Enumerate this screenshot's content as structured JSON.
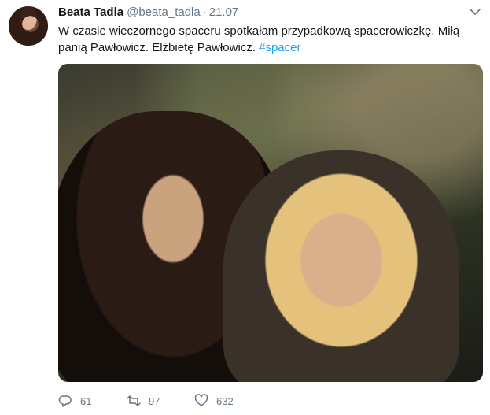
{
  "tweet": {
    "author_name": "Beata Tadla",
    "author_handle": "@beata_tadla",
    "separator": "·",
    "date": "21.07",
    "text_part1": "W czasie wieczornego spaceru spotkałam przypadkową spacerowiczkę. Miłą panią Pawłowicz. Elżbietę Pawłowicz. ",
    "hashtag": "#spacer",
    "stats": {
      "replies": "61",
      "retweets": "97",
      "likes": "632"
    }
  },
  "icons": {
    "caret": "chevron-down-icon",
    "reply": "reply-icon",
    "retweet": "retweet-icon",
    "like": "heart-icon"
  },
  "colors": {
    "link": "#1da1f2",
    "muted": "#657786",
    "text": "#14171a"
  }
}
